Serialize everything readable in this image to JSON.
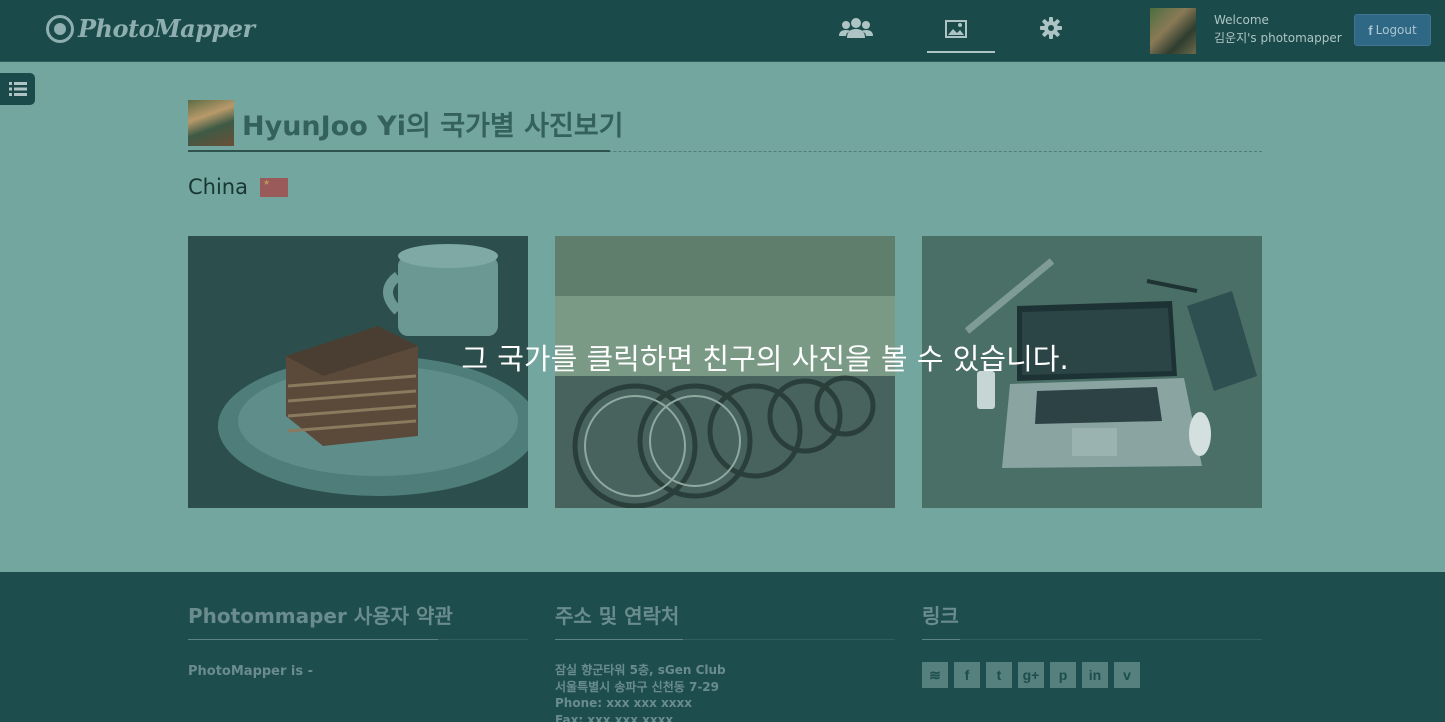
{
  "header": {
    "logo_text": "PhotoMapper",
    "nav": [
      {
        "name": "friends",
        "icon": "users-icon",
        "glyph": "👥"
      },
      {
        "name": "photos",
        "icon": "image-icon",
        "glyph": "▭"
      },
      {
        "name": "settings",
        "icon": "gear-icon",
        "glyph": "⚙"
      }
    ],
    "welcome_line1": "Welcome",
    "welcome_line2": "김운지's photomapper",
    "logout_prefix": "f",
    "logout_label": "Logout"
  },
  "main": {
    "page_title": "HyunJoo Yi의 국가별 사진보기",
    "country": "China",
    "overlay_message": "그 국가를 클릭하면 친구의 사진을 볼 수 있습니다.",
    "photos": [
      {
        "subject": "cake"
      },
      {
        "subject": "bicycles"
      },
      {
        "subject": "laptop"
      }
    ]
  },
  "footer": {
    "col1": {
      "heading": "Photommaper 사용자 약관",
      "text": "PhotoMapper is -"
    },
    "col2": {
      "heading": "주소 및 연락처",
      "address1": "잠실 향군타워 5층, sGen Club",
      "address2": "서울특별시 송파구 신천동 7-29",
      "phone": "Phone: xxx xxx xxxx",
      "fax": "Fax: xxx xxx xxxx"
    },
    "col3": {
      "heading": "링크",
      "social": [
        {
          "name": "rss-icon",
          "glyph": "≋"
        },
        {
          "name": "facebook-icon",
          "glyph": "f"
        },
        {
          "name": "twitter-icon",
          "glyph": "t"
        },
        {
          "name": "google-plus-icon",
          "glyph": "g+"
        },
        {
          "name": "pinterest-icon",
          "glyph": "p"
        },
        {
          "name": "linkedin-icon",
          "glyph": "in"
        },
        {
          "name": "vimeo-icon",
          "glyph": "v"
        }
      ]
    }
  },
  "colors": {
    "header_bg": "#1a4a4a",
    "overlay_bg": "#74a6a0",
    "footer_bg": "#1d4d4d",
    "logout_bg": "#2f6884"
  }
}
